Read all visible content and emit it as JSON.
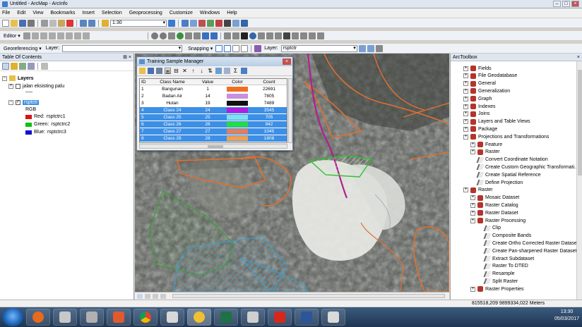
{
  "window": {
    "title": "Untitled - ArcMap - ArcInfo"
  },
  "menu": [
    "File",
    "Edit",
    "View",
    "Bookmarks",
    "Insert",
    "Selection",
    "Geoprocessing",
    "Customize",
    "Windows",
    "Help"
  ],
  "standard_toolbar": {
    "scale": "1:30"
  },
  "editor_toolbar": {
    "label": "Editor ▾"
  },
  "georef_toolbar": {
    "label": "Georeferencing ▾",
    "layer_label": "Layer:",
    "snapping_label": "Snapping ▾",
    "layer2_label": "Layer:",
    "layer2_value": "rsptctr"
  },
  "toc": {
    "title": "Table Of Contents",
    "root": "Layers",
    "layer1": "jalan eksisting palu",
    "layer2": "rsptctr",
    "rgb_label": "RGB",
    "bands": [
      {
        "label": "Red:",
        "value": "rsptctrc1",
        "color": "#e01010"
      },
      {
        "label": "Green:",
        "value": "rsptctrc2",
        "color": "#10c010"
      },
      {
        "label": "Blue:",
        "value": "rsptctrc3",
        "color": "#1010d0"
      }
    ]
  },
  "dialog": {
    "title": "Training Sample Manager",
    "columns": [
      "ID",
      "Class Name",
      "Value",
      "Color",
      "Count"
    ],
    "rows": [
      {
        "id": "1",
        "name": "Bangunan",
        "value": "1",
        "color": "#f07020",
        "count": "22691",
        "selected": false
      },
      {
        "id": "2",
        "name": "Badan Air",
        "value": "14",
        "color": "#c890e0",
        "count": "7805",
        "selected": false
      },
      {
        "id": "3",
        "name": "Hutan",
        "value": "19",
        "color": "#111111",
        "count": "7489",
        "selected": false
      },
      {
        "id": "4",
        "name": "Class 24",
        "value": "24",
        "color": "#b020e0",
        "count": "3545",
        "selected": true
      },
      {
        "id": "5",
        "name": "Class 25",
        "value": "25",
        "color": "#80e0f0",
        "count": "705",
        "selected": true
      },
      {
        "id": "6",
        "name": "Class 26",
        "value": "26",
        "color": "#20e040",
        "count": "942",
        "selected": true
      },
      {
        "id": "7",
        "name": "Class 27",
        "value": "27",
        "color": "#e08060",
        "count": "1045",
        "selected": true
      },
      {
        "id": "8",
        "name": "Class 28",
        "value": "28",
        "color": "#f0a050",
        "count": "1808",
        "selected": true
      }
    ]
  },
  "toolbox": {
    "title": "ArcToolbox",
    "items": [
      {
        "label": "Fields",
        "level": 0,
        "kind": "toolset"
      },
      {
        "label": "File Geodatabase",
        "level": 0,
        "kind": "toolset"
      },
      {
        "label": "General",
        "level": 0,
        "kind": "toolset"
      },
      {
        "label": "Generalization",
        "level": 0,
        "kind": "toolset"
      },
      {
        "label": "Graph",
        "level": 0,
        "kind": "toolset"
      },
      {
        "label": "Indexes",
        "level": 0,
        "kind": "toolset"
      },
      {
        "label": "Joins",
        "level": 0,
        "kind": "toolset"
      },
      {
        "label": "Layers and Table Views",
        "level": 0,
        "kind": "toolset"
      },
      {
        "label": "Package",
        "level": 0,
        "kind": "toolset"
      },
      {
        "label": "Projections and Transformations",
        "level": 0,
        "kind": "toolset"
      },
      {
        "label": "Feature",
        "level": 1,
        "kind": "toolset"
      },
      {
        "label": "Raster",
        "level": 1,
        "kind": "toolset"
      },
      {
        "label": "Convert Coordinate Notation",
        "level": 1,
        "kind": "tool"
      },
      {
        "label": "Create Custom Geographic Transformati...",
        "level": 1,
        "kind": "tool"
      },
      {
        "label": "Create Spatial Reference",
        "level": 1,
        "kind": "tool"
      },
      {
        "label": "Define Projection",
        "level": 1,
        "kind": "tool"
      },
      {
        "label": "Raster",
        "level": 0,
        "kind": "toolset"
      },
      {
        "label": "Mosaic Dataset",
        "level": 1,
        "kind": "toolset"
      },
      {
        "label": "Raster Catalog",
        "level": 1,
        "kind": "toolset"
      },
      {
        "label": "Raster Dataset",
        "level": 1,
        "kind": "toolset"
      },
      {
        "label": "Raster Processing",
        "level": 1,
        "kind": "toolset"
      },
      {
        "label": "Clip",
        "level": 2,
        "kind": "tool"
      },
      {
        "label": "Composite Bands",
        "level": 2,
        "kind": "tool"
      },
      {
        "label": "Create Ortho Corrected Raster Dataset",
        "level": 2,
        "kind": "tool"
      },
      {
        "label": "Create Pan-sharpened Raster Dataset",
        "level": 2,
        "kind": "tool"
      },
      {
        "label": "Extract Subdataset",
        "level": 2,
        "kind": "tool"
      },
      {
        "label": "Raster To DTED",
        "level": 2,
        "kind": "tool"
      },
      {
        "label": "Resample",
        "level": 2,
        "kind": "tool"
      },
      {
        "label": "Split Raster",
        "level": 2,
        "kind": "tool"
      },
      {
        "label": "Raster Properties",
        "level": 1,
        "kind": "toolset"
      }
    ]
  },
  "status": {
    "coords": "815518,209  9899334,022 Meters"
  },
  "taskbar": {
    "time": "13:30",
    "date": "05/03/2017"
  }
}
